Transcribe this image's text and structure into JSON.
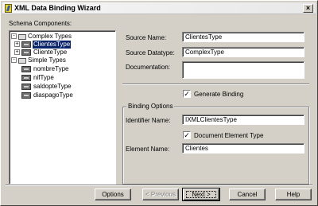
{
  "window": {
    "title": "XML Data Binding Wizard",
    "close": "×"
  },
  "tree": {
    "label": "Schema Components:",
    "groups": [
      {
        "label": "Complex Types",
        "expander": "-"
      },
      {
        "label": "Simple Types",
        "expander": "-"
      }
    ],
    "complex_items": [
      {
        "label": "ClientesType",
        "expander": "+",
        "selected": true
      },
      {
        "label": "ClienteType",
        "expander": "+"
      }
    ],
    "simple_items": [
      {
        "label": "nombreType"
      },
      {
        "label": "nifType"
      },
      {
        "label": "saldopteType"
      },
      {
        "label": "diaspagoType"
      }
    ]
  },
  "form": {
    "source_name_label": "Source Name:",
    "source_name_value": "ClientesType",
    "source_datatype_label": "Source Datatype:",
    "source_datatype_value": "ComplexType",
    "documentation_label": "Documentation:",
    "documentation_value": "",
    "generate_binding_label": "Generate Binding",
    "generate_binding_checked": true,
    "binding_options_label": "Binding Options",
    "identifier_name_label": "Identifier Name:",
    "identifier_name_value": "IXMLClientesType",
    "document_element_type_label": "Document Element Type",
    "document_element_type_checked": true,
    "element_name_label": "Element Name:",
    "element_name_value": "Clientes"
  },
  "buttons": {
    "options": "Options",
    "previous": "< Previous",
    "next": "Next >",
    "cancel": "Cancel",
    "help": "Help"
  },
  "check_mark": "✓"
}
